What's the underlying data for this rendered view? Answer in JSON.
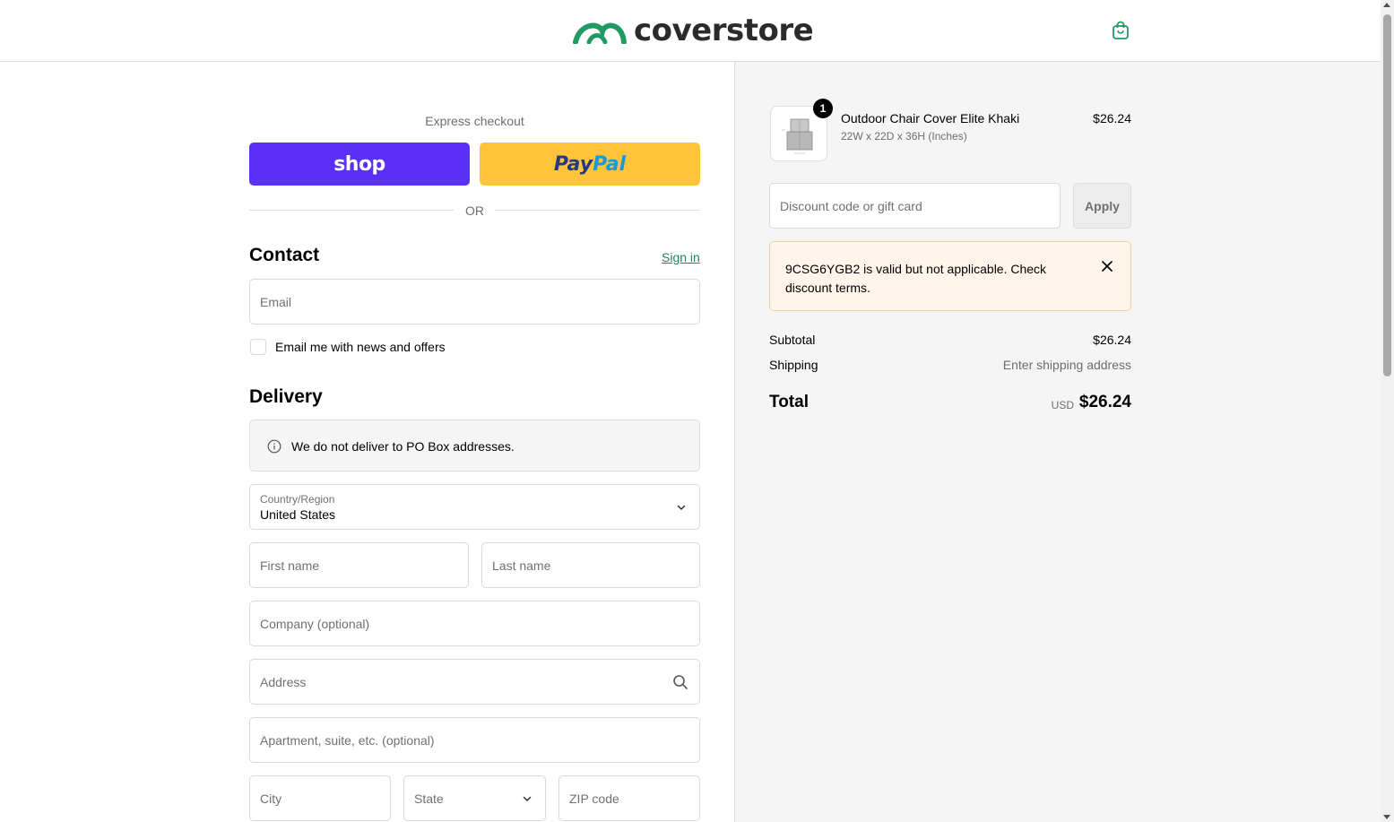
{
  "header": {
    "brand": "coverstore",
    "brand_color": "#1f9a63",
    "cart_icon": "shopping-bag-icon"
  },
  "express": {
    "label": "Express checkout",
    "shop_label": "shop",
    "paypal_label_1": "Pay",
    "paypal_label_2": "Pal",
    "or_label": "OR"
  },
  "contact": {
    "title": "Contact",
    "sign_in": "Sign in",
    "email_placeholder": "Email",
    "newsletter_label": "Email me with news and offers"
  },
  "delivery": {
    "title": "Delivery",
    "notice": "We do not deliver to PO Box addresses.",
    "country_label": "Country/Region",
    "country_value": "United States",
    "first_name": "First name",
    "last_name": "Last name",
    "company": "Company (optional)",
    "address": "Address",
    "apartment": "Apartment, suite, etc. (optional)",
    "city": "City",
    "state": "State",
    "zip": "ZIP code"
  },
  "order": {
    "item": {
      "quantity": "1",
      "name": "Outdoor Chair Cover Elite Khaki",
      "variant": "22W x 22D x 36H (Inches)",
      "price": "$26.24"
    },
    "discount_placeholder": "Discount code or gift card",
    "apply_label": "Apply",
    "alert_message": "9CSG6YGB2 is valid but not applicable. Check discount terms.",
    "subtotal_label": "Subtotal",
    "subtotal_value": "$26.24",
    "shipping_label": "Shipping",
    "shipping_value": "Enter shipping address",
    "total_label": "Total",
    "total_currency": "USD",
    "total_value": "$26.24"
  },
  "colors": {
    "shop_pay": "#5a31f4",
    "paypal": "#ffc439",
    "link": "#1a8a5a",
    "alert_bg": "#fff5eb"
  }
}
